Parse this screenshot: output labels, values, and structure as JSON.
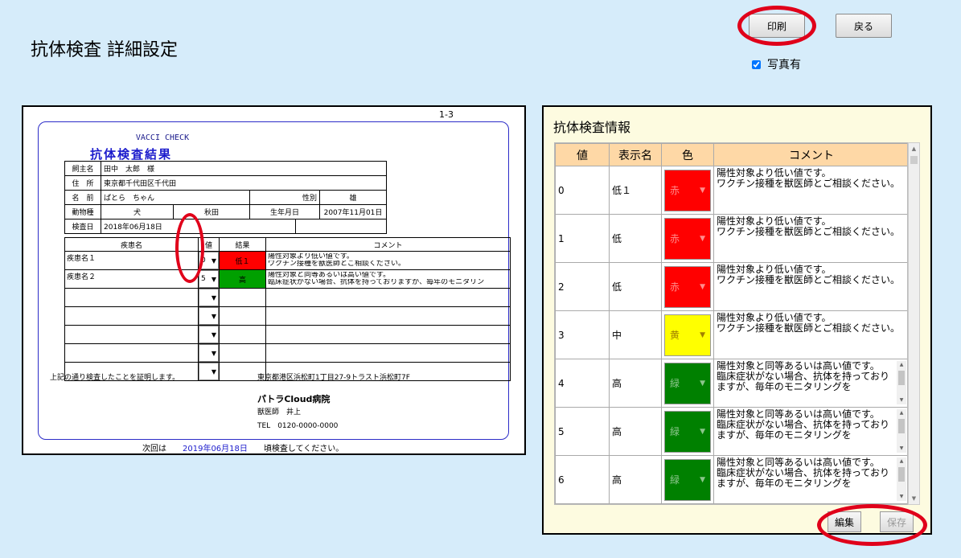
{
  "page": {
    "title": "抗体検査 詳細設定"
  },
  "toolbar": {
    "print": "印刷",
    "back": "戻る",
    "photo_label": "写真有",
    "photo_checked": true
  },
  "preview": {
    "page_no": "1-3",
    "brand": "VACCI CHECK",
    "title": "抗体検査結果",
    "owner_label": "飼主名",
    "owner": "田中　太郎　様",
    "address_label": "住　所",
    "address": "東京都千代田区千代田",
    "name_label": "名　前",
    "pet_name": "ぱとら　ちゃん",
    "sex_label": "性別",
    "sex": "雄",
    "species_label": "動物種",
    "species": "犬",
    "breed": "秋田",
    "birth_label": "生年月日",
    "birth": "2007年11月01日",
    "exam_label": "検査日",
    "exam_date": "2018年06月18日",
    "headers": {
      "disease": "疾患名",
      "value": "値",
      "result": "結果",
      "comment": "コメント"
    },
    "rows": [
      {
        "name": "疾患名１",
        "value": "0",
        "result": "低１",
        "result_color": "#ff0000",
        "comment1": "陽性対象より低い値です。",
        "comment2": "ワクチン接種を獣医師とご相談ください。"
      },
      {
        "name": "疾患名２",
        "value": "5",
        "result": "高",
        "result_color": "#00a000",
        "comment1": "陽性対象と同等あるいは高い値です。",
        "comment2": "臨床症状がない場合、抗体を持っておりますが、毎年のモニタリン"
      },
      {
        "name": "",
        "value": "",
        "result": "",
        "result_color": "",
        "comment1": "",
        "comment2": ""
      },
      {
        "name": "",
        "value": "",
        "result": "",
        "result_color": "",
        "comment1": "",
        "comment2": ""
      },
      {
        "name": "",
        "value": "",
        "result": "",
        "result_color": "",
        "comment1": "",
        "comment2": ""
      },
      {
        "name": "",
        "value": "",
        "result": "",
        "result_color": "",
        "comment1": "",
        "comment2": ""
      },
      {
        "name": "",
        "value": "",
        "result": "",
        "result_color": "",
        "comment1": "",
        "comment2": ""
      }
    ],
    "certify": "上記の通り検査したことを証明します。",
    "clinic_address": "東京都港区浜松町1丁目27-9トラスト浜松町7F",
    "clinic_name": "パトラCloud病院",
    "vet": "獣医師　井上",
    "tel": "TEL　0120-0000-0000",
    "next_prefix": "次回は",
    "next_date": "2019年06月18日",
    "next_suffix": "頃検査してください。"
  },
  "info": {
    "title": "抗体検査情報",
    "headers": {
      "value": "値",
      "label": "表示名",
      "color": "色",
      "comment": "コメント"
    },
    "rows": [
      {
        "value": "0",
        "label": "低１",
        "color_name": "赤",
        "color_hex": "#ff0000",
        "comment": "陽性対象より低い値です。\nワクチン接種を獣医師とご相談ください。"
      },
      {
        "value": "1",
        "label": "低",
        "color_name": "赤",
        "color_hex": "#ff0000",
        "comment": "陽性対象より低い値です。\nワクチン接種を獣医師とご相談ください。"
      },
      {
        "value": "2",
        "label": "低",
        "color_name": "赤",
        "color_hex": "#ff0000",
        "comment": "陽性対象より低い値です。\nワクチン接種を獣医師とご相談ください。"
      },
      {
        "value": "3",
        "label": "中",
        "color_name": "黄",
        "color_hex": "#ffff00",
        "comment": "陽性対象より低い値です。\nワクチン接種を獣医師とご相談ください。"
      },
      {
        "value": "4",
        "label": "高",
        "color_name": "緑",
        "color_hex": "#008000",
        "comment": "陽性対象と同等あるいは高い値です。\n臨床症状がない場合、抗体を持っておりますが、毎年のモニタリングを"
      },
      {
        "value": "5",
        "label": "高",
        "color_name": "緑",
        "color_hex": "#008000",
        "comment": "陽性対象と同等あるいは高い値です。\n臨床症状がない場合、抗体を持っておりますが、毎年のモニタリングを"
      },
      {
        "value": "6",
        "label": "高",
        "color_name": "緑",
        "color_hex": "#008000",
        "comment": "陽性対象と同等あるいは高い値です。\n臨床症状がない場合、抗体を持っておりますが、毎年のモニタリングを"
      }
    ],
    "edit": "編集",
    "save": "保存"
  }
}
